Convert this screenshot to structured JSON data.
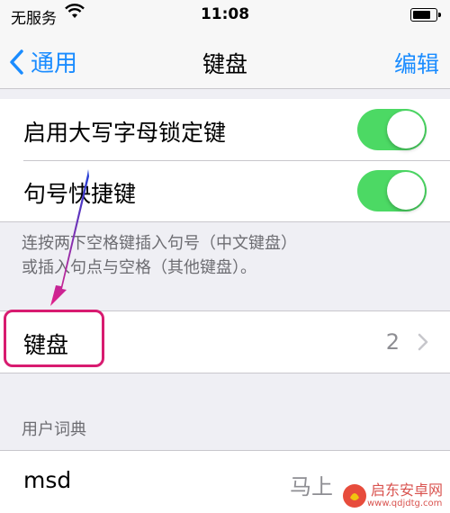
{
  "status_bar": {
    "carrier": "无服务",
    "time": "11:08",
    "battery_level": 0.85
  },
  "nav": {
    "back_label": "通用",
    "title": "键盘",
    "edit_label": "编辑"
  },
  "settings": {
    "caps_lock": {
      "label": "启用大写字母锁定键",
      "enabled": true
    },
    "period_shortcut": {
      "label": "句号快捷键",
      "enabled": true
    },
    "footer_line1": "连按两下空格键插入句号（中文键盘）",
    "footer_line2": "或插入句点与空格（其他键盘）。"
  },
  "keyboards": {
    "label": "键盘",
    "count": "2"
  },
  "user_dictionary": {
    "header": "用户词典",
    "items": [
      {
        "phrase": "msd",
        "shortcut": "马上"
      }
    ]
  },
  "watermark": {
    "name": "启东安卓网",
    "url": "www.qdjdtg.com"
  },
  "colors": {
    "accent": "#1a8cff",
    "toggle_on": "#4cd964",
    "annotation": "#d81b70"
  }
}
